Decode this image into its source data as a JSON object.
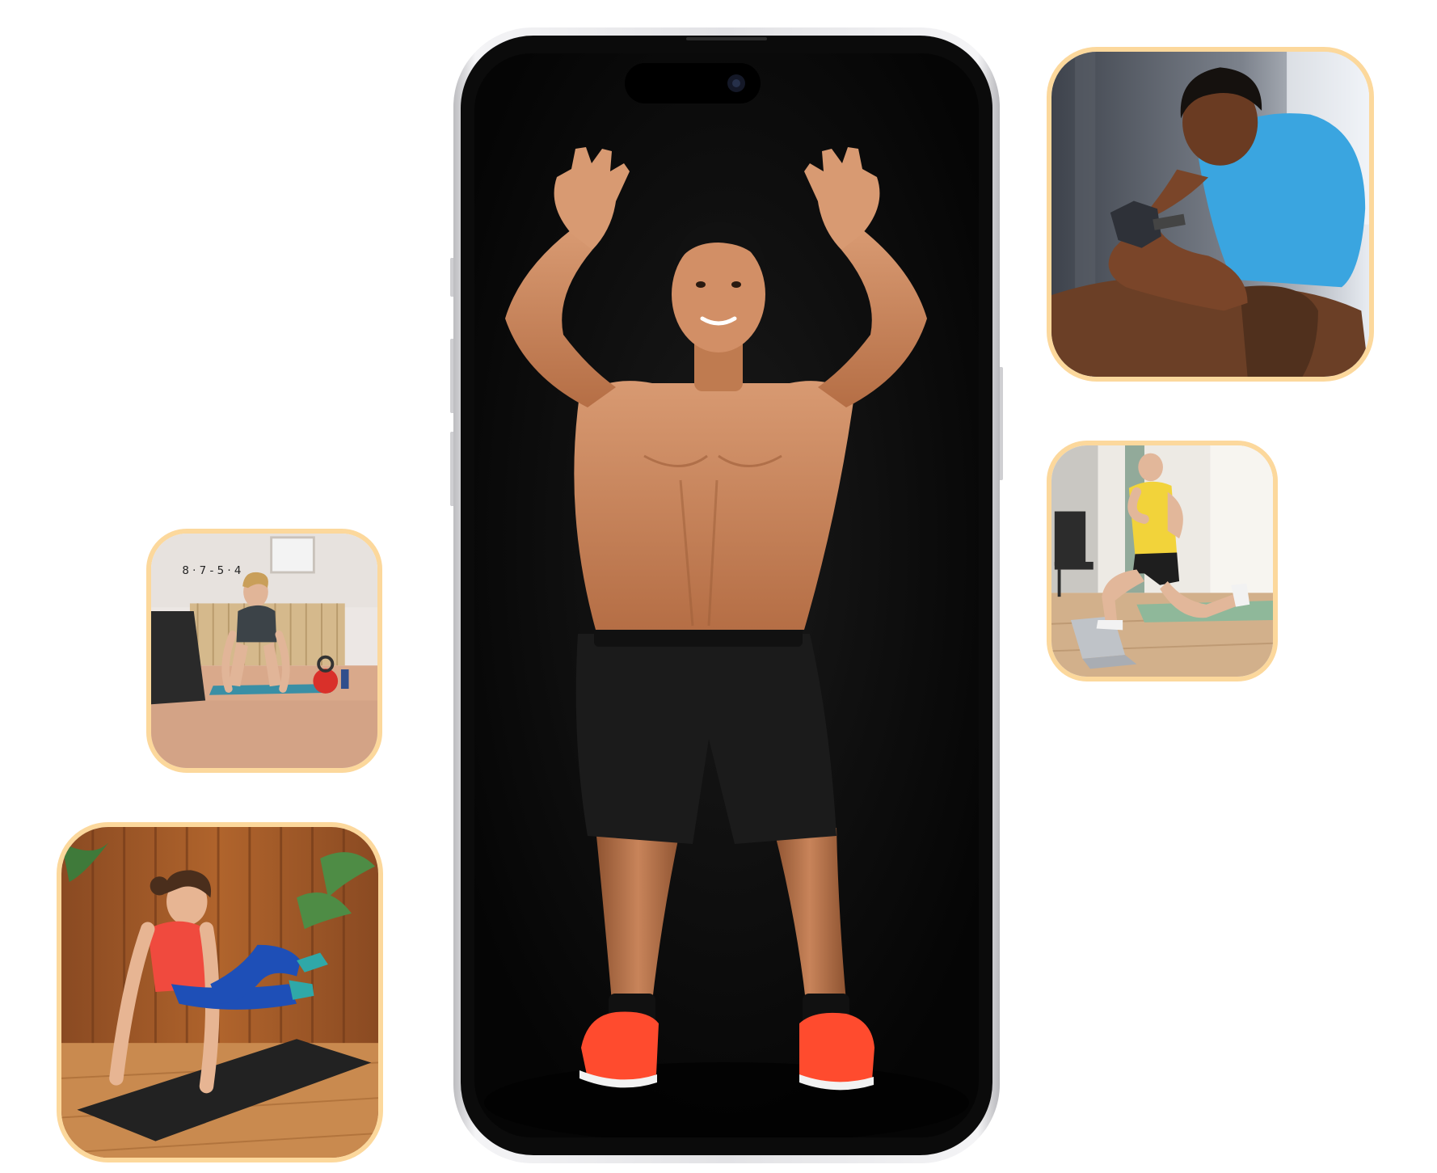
{
  "colors": {
    "card_border": "#FCD89C",
    "phone_frame": "#E6E6E8",
    "phone_bezel": "#0B0B0B",
    "screen_background": "#080808",
    "shoe_accent": "#FF4B2E"
  },
  "phone": {
    "screen": "man-standing-arms-raised-photo",
    "icons": [
      "front-camera-icon",
      "speaker-grille-icon"
    ]
  },
  "gallery": {
    "cards": [
      {
        "id": "dumbbell-curl",
        "subject": "man-dumbbell-curl-photo"
      },
      {
        "id": "lunge",
        "subject": "man-lunge-home-photo"
      },
      {
        "id": "plank",
        "subject": "woman-plank-home-photo"
      },
      {
        "id": "mountain-climber",
        "subject": "woman-mountain-climber-photo"
      }
    ]
  }
}
